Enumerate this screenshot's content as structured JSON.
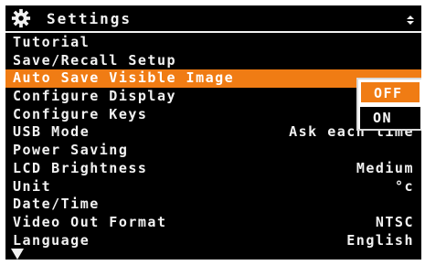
{
  "header": {
    "title": "Settings",
    "icon": "gear-icon",
    "scroll_icon": "updown-icon"
  },
  "menu": {
    "items": [
      {
        "label": "Tutorial",
        "value": ""
      },
      {
        "label": "Save/Recall Setup",
        "value": ""
      },
      {
        "label": "Auto Save Visible Image",
        "value": "",
        "selected": true
      },
      {
        "label": "Configure Display",
        "value": ""
      },
      {
        "label": "Configure Keys",
        "value": ""
      },
      {
        "label": "USB Mode",
        "value": "Ask each time"
      },
      {
        "label": "Power Saving",
        "value": ""
      },
      {
        "label": "LCD Brightness",
        "value": "Medium"
      },
      {
        "label": "Unit",
        "value": "°c"
      },
      {
        "label": "Date/Time",
        "value": ""
      },
      {
        "label": "Video Out Format",
        "value": "NTSC"
      },
      {
        "label": "Language",
        "value": "English"
      }
    ]
  },
  "popup": {
    "options": [
      "OFF",
      "ON"
    ],
    "selected": "OFF"
  },
  "footer": {
    "more_icon": "scroll-down-arrow-icon"
  },
  "colors": {
    "highlight": "#f07c14",
    "background": "#000000",
    "text": "#f2f2f2"
  }
}
